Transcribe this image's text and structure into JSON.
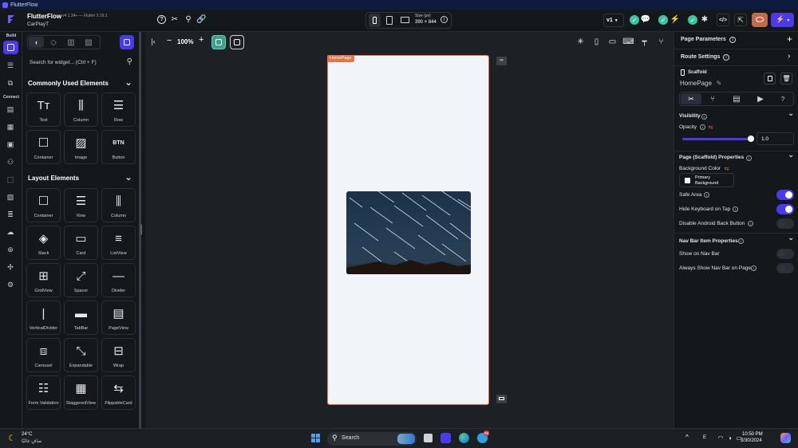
{
  "window": {
    "title": "FlutterFlow"
  },
  "header": {
    "app_name": "FlutterFlow",
    "version": "v4.1.34+ — Flutter 3.19.1",
    "project": "CarPlayT",
    "size_label": "Size (px)",
    "size_value": "390 × 844",
    "version_select": "v1"
  },
  "rail": {
    "build_label": "Build",
    "connect_label": "Connect"
  },
  "widgets": {
    "search_placeholder": "Search for widget... (Ctrl + F)",
    "common_title": "Commonly Used Elements",
    "common": [
      "Text",
      "Column",
      "Row",
      "Container",
      "Image",
      "Button"
    ],
    "layout_title": "Layout Elements",
    "layout": [
      "Container",
      "Row",
      "Column",
      "Stack",
      "Card",
      "ListView",
      "GridView",
      "Spacer",
      "Divider",
      "VerticalDivider",
      "TabBar",
      "PageView",
      "Carousel",
      "Expandable",
      "Wrap",
      "Form Validation",
      "StaggeredView",
      "FlippableCard"
    ]
  },
  "canvas": {
    "zoom": "100%",
    "page_tag": "HomePage"
  },
  "properties": {
    "page_parameters": "Page Parameters",
    "route_settings": "Route Settings",
    "widget_type": "Scaffold",
    "widget_name": "HomePage",
    "visibility": "Visibility",
    "opacity_label": "Opacity",
    "opacity_value": "1.0",
    "opacity_fraction": 1.0,
    "scaffold_title": "Page (Scaffold) Properties",
    "bg_color_label": "Background Color",
    "bg_color_line1": "Primary",
    "bg_color_line2": "Background",
    "safe_area": "Safe Area",
    "hide_keyboard": "Hide Keyboard on Tap",
    "disable_back": "Disable Android Back Button",
    "nav_title": "Nav Bar Item Properties",
    "show_nav": "Show on Nav Bar",
    "always_show_nav": "Always Show Nav Bar on Page"
  },
  "taskbar": {
    "temp": "24°C",
    "weather": "صافٍ غالبًا",
    "search": "Search",
    "time": "10:50 PM",
    "date": "3/30/2024",
    "lang": "E",
    "badge": "99"
  },
  "colors": {
    "accent": "#4b39ef",
    "page_border": "#e2764a",
    "toggle_on": "#4b39ef",
    "toggle_off": "#2a2f35"
  }
}
